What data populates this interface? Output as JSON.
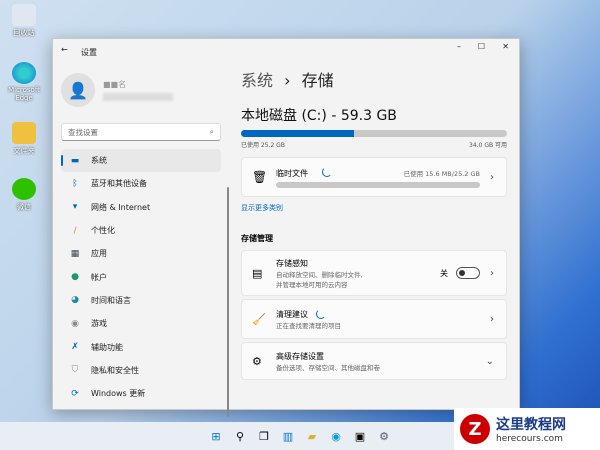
{
  "desktop": {
    "icons": [
      {
        "label": "回收站"
      },
      {
        "label": "Microsoft Edge"
      },
      {
        "label": "文件夹"
      },
      {
        "label": "微信"
      }
    ]
  },
  "window": {
    "title": "设置",
    "user_name": "■■名"
  },
  "search": {
    "placeholder": "查找设置"
  },
  "nav": [
    {
      "label": "系统",
      "icon": "monitor-icon"
    },
    {
      "label": "蓝牙和其他设备",
      "icon": "bluetooth-icon"
    },
    {
      "label": "网络 & Internet",
      "icon": "wifi-icon"
    },
    {
      "label": "个性化",
      "icon": "brush-icon"
    },
    {
      "label": "应用",
      "icon": "apps-icon"
    },
    {
      "label": "帐户",
      "icon": "person-icon"
    },
    {
      "label": "时间和语言",
      "icon": "globe-icon"
    },
    {
      "label": "游戏",
      "icon": "gamepad-icon"
    },
    {
      "label": "辅助功能",
      "icon": "accessibility-icon"
    },
    {
      "label": "隐私和安全性",
      "icon": "shield-icon"
    },
    {
      "label": "Windows 更新",
      "icon": "update-icon"
    }
  ],
  "breadcrumb": {
    "parent": "系统",
    "sep": "›",
    "current": "存储"
  },
  "disk": {
    "title": "本地磁盘 (C:) - 59.3 GB",
    "used": "已使用 25.2 GB",
    "free": "34.0 GB 可用",
    "used_percent": 42.5
  },
  "temp": {
    "label": "临时文件",
    "usage": "已使用 15.6 MB/25.2 GB"
  },
  "show_more": "显示更多类别",
  "storage_mgmt": {
    "heading": "存储管理",
    "sense": {
      "title": "存储感知",
      "desc1": "自动释放空间、删除临时文件,",
      "desc2": "并管理本地可用的云内容",
      "toggle_label": "关"
    },
    "cleanup": {
      "title": "清理建议",
      "desc": "正在查找要清理的项目"
    },
    "advanced": {
      "title": "高级存储设置",
      "desc": "备份选项、存储空间、其他磁盘和卷"
    }
  },
  "watermark": {
    "name": "这里教程网",
    "url": "herecours.com"
  },
  "colors": {
    "accent": "#0067c0"
  }
}
